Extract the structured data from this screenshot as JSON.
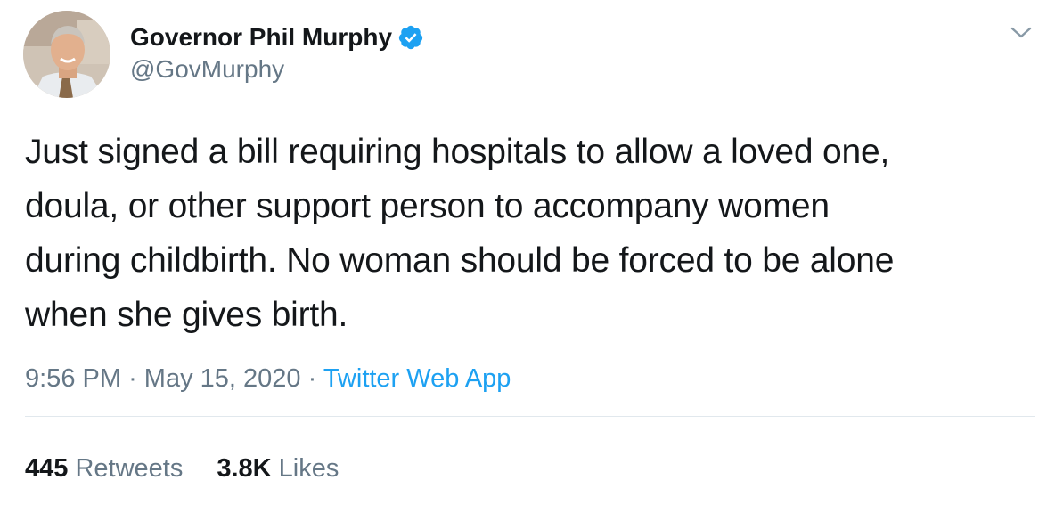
{
  "tweet": {
    "author": {
      "display_name": "Governor Phil Murphy",
      "handle": "@GovMurphy",
      "verified": true
    },
    "text_lines": [
      "Just signed a bill requiring hospitals to allow a loved one,",
      "doula, or other support person to accompany women",
      "during childbirth. No woman should be forced to be alone",
      "when she gives birth."
    ],
    "time": "9:56 PM",
    "separator": "·",
    "date": "May 15, 2020",
    "source": "Twitter Web App",
    "stats": {
      "retweets_count": "445",
      "retweets_label": "Retweets",
      "likes_count": "3.8K",
      "likes_label": "Likes"
    }
  },
  "colors": {
    "verified_badge": "#1da1f2",
    "link": "#1da1f2",
    "secondary_text": "#657786",
    "primary_text": "#14171a"
  },
  "icons": {
    "verified": "verified-badge-icon",
    "menu": "chevron-down-icon"
  }
}
